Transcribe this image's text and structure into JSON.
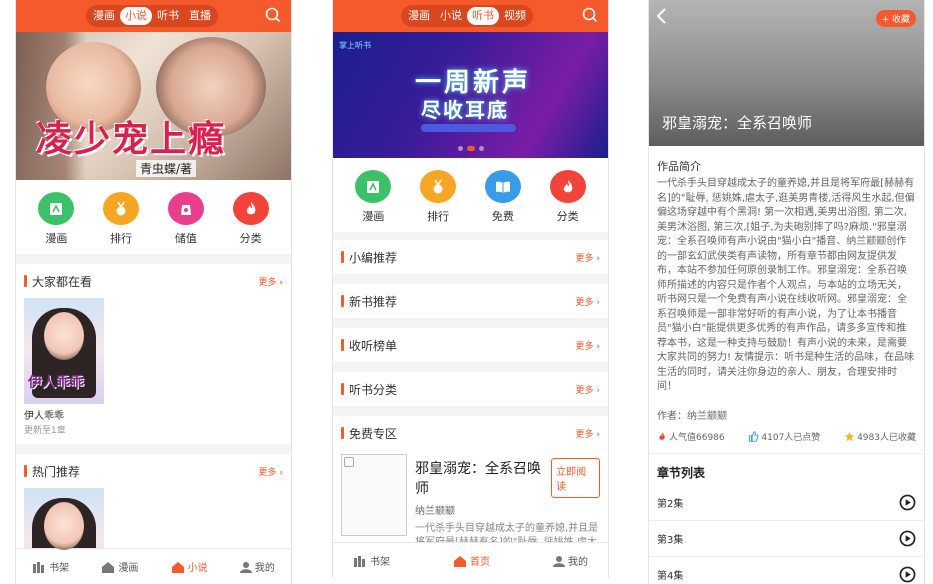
{
  "phone1": {
    "tabs": [
      "漫画",
      "小说",
      "听书",
      "直播"
    ],
    "active_tab": "小说",
    "banner": {
      "title": "凌少宠上瘾",
      "subtitle": "青虫蝶/著"
    },
    "grid": [
      {
        "label": "漫画",
        "icon": "comic-icon",
        "color": "#3cc06a"
      },
      {
        "label": "排行",
        "icon": "medal-icon",
        "color": "#f6a623"
      },
      {
        "label": "储值",
        "icon": "recharge-icon",
        "color": "#e83e8c"
      },
      {
        "label": "分类",
        "icon": "flame-icon",
        "color": "#f2443a"
      }
    ],
    "section1": {
      "title": "大家都在看",
      "more": "更多",
      "book": {
        "cover_title": "伊人乖乖",
        "name": "伊人乖乖",
        "update": "更新至1章"
      }
    },
    "section2": {
      "title": "热门推荐",
      "more": "更多"
    },
    "tabbar": [
      {
        "label": "书架",
        "icon": "bookshelf-icon"
      },
      {
        "label": "漫画",
        "icon": "house-icon"
      },
      {
        "label": "小说",
        "icon": "house-icon",
        "active": true
      },
      {
        "label": "我的",
        "icon": "user-icon"
      }
    ]
  },
  "phone2": {
    "tabs": [
      "漫画",
      "小说",
      "听书",
      "视频"
    ],
    "active_tab": "听书",
    "banner": {
      "logo": "掌上听书",
      "line1": "一周新声",
      "line2": "尽收耳底"
    },
    "grid": [
      {
        "label": "漫画",
        "icon": "comic-icon",
        "color": "#3cc06a"
      },
      {
        "label": "排行",
        "icon": "medal-icon",
        "color": "#f6a623"
      },
      {
        "label": "免费",
        "icon": "open-book-icon",
        "color": "#3a9be8"
      },
      {
        "label": "分类",
        "icon": "flame-icon",
        "color": "#f2443a"
      }
    ],
    "rows": [
      {
        "title": "小编推荐",
        "more": "更多"
      },
      {
        "title": "新书推荐",
        "more": "更多"
      },
      {
        "title": "收听榜单",
        "more": "更多"
      },
      {
        "title": "听书分类",
        "more": "更多"
      }
    ],
    "free": {
      "title": "免费专区",
      "more": "更多",
      "book": {
        "title": "邪皇溺宠：全系召唤师",
        "author": "纳兰颛颛",
        "read_btn": "立即阅读",
        "desc": "一代杀手头目穿越成太子的童养媳,并且是将军府最[赫赫有名]的\"耻辱, 惩姚姝,虐太子,"
      }
    },
    "tabbar": [
      {
        "label": "书架",
        "icon": "bookshelf-icon"
      },
      {
        "label": "首页",
        "icon": "house-icon",
        "active": true
      },
      {
        "label": "我的",
        "icon": "user-icon"
      }
    ]
  },
  "phone3": {
    "fav_btn": "+ 收藏",
    "title": "邪皇溺宠：全系召唤师",
    "intro_heading": "作品简介",
    "intro_text": "一代杀手头目穿越成太子的童养媳,并且是将军府最[赫赫有名]的\"耻辱, 惩姚姝,虐太子,逛美男青楼,活得风生水起,但偏偏这场穿越中有个黑洞! 第一次相遇,美男出浴图, 第二次,美男沐浴图, 第三次,[姐子,为夫砲别摔了吗?麻烦.\"邪皇溺宠：全系召唤师有声小说由\"猫小白\"播音、纳兰颛颛创作的一部玄幻武侠类有声读物，所有章节都由网友提供发布，本站不参加任何原创录制工作。邪皇溺宠：全系召唤师所描述的内容只是作者个人观点，与本站的立场无关，听书网只是一个免费有声小说在线收听网。邪皇溺宠：全系召唤师是一部非常好听的有声小说，为了让本书播音员\"猫小白\"能提供更多优秀的有声作品，请多多宣传和推荐本书，这是一种支持与鼓励！有声小说的未来，是需要大家共同的努力! 友情提示：听书是种生活的品味，在品味生活的同时，请关注你身边的亲人、朋友，合理安排时间！",
    "author": "作者：纳兰颛颛",
    "stats": [
      {
        "text": "人气值66986",
        "icon": "flame-icon",
        "color": "#f2443a"
      },
      {
        "text": "4107人已点赞",
        "icon": "thumb-up-icon",
        "color": "#3a9be8"
      },
      {
        "text": "4983人已收藏",
        "icon": "star-icon",
        "color": "#f6b623"
      }
    ],
    "chapter_heading": "章节列表",
    "chapters": [
      "第2集",
      "第3集",
      "第4集"
    ]
  },
  "accent": "#f55a2c"
}
